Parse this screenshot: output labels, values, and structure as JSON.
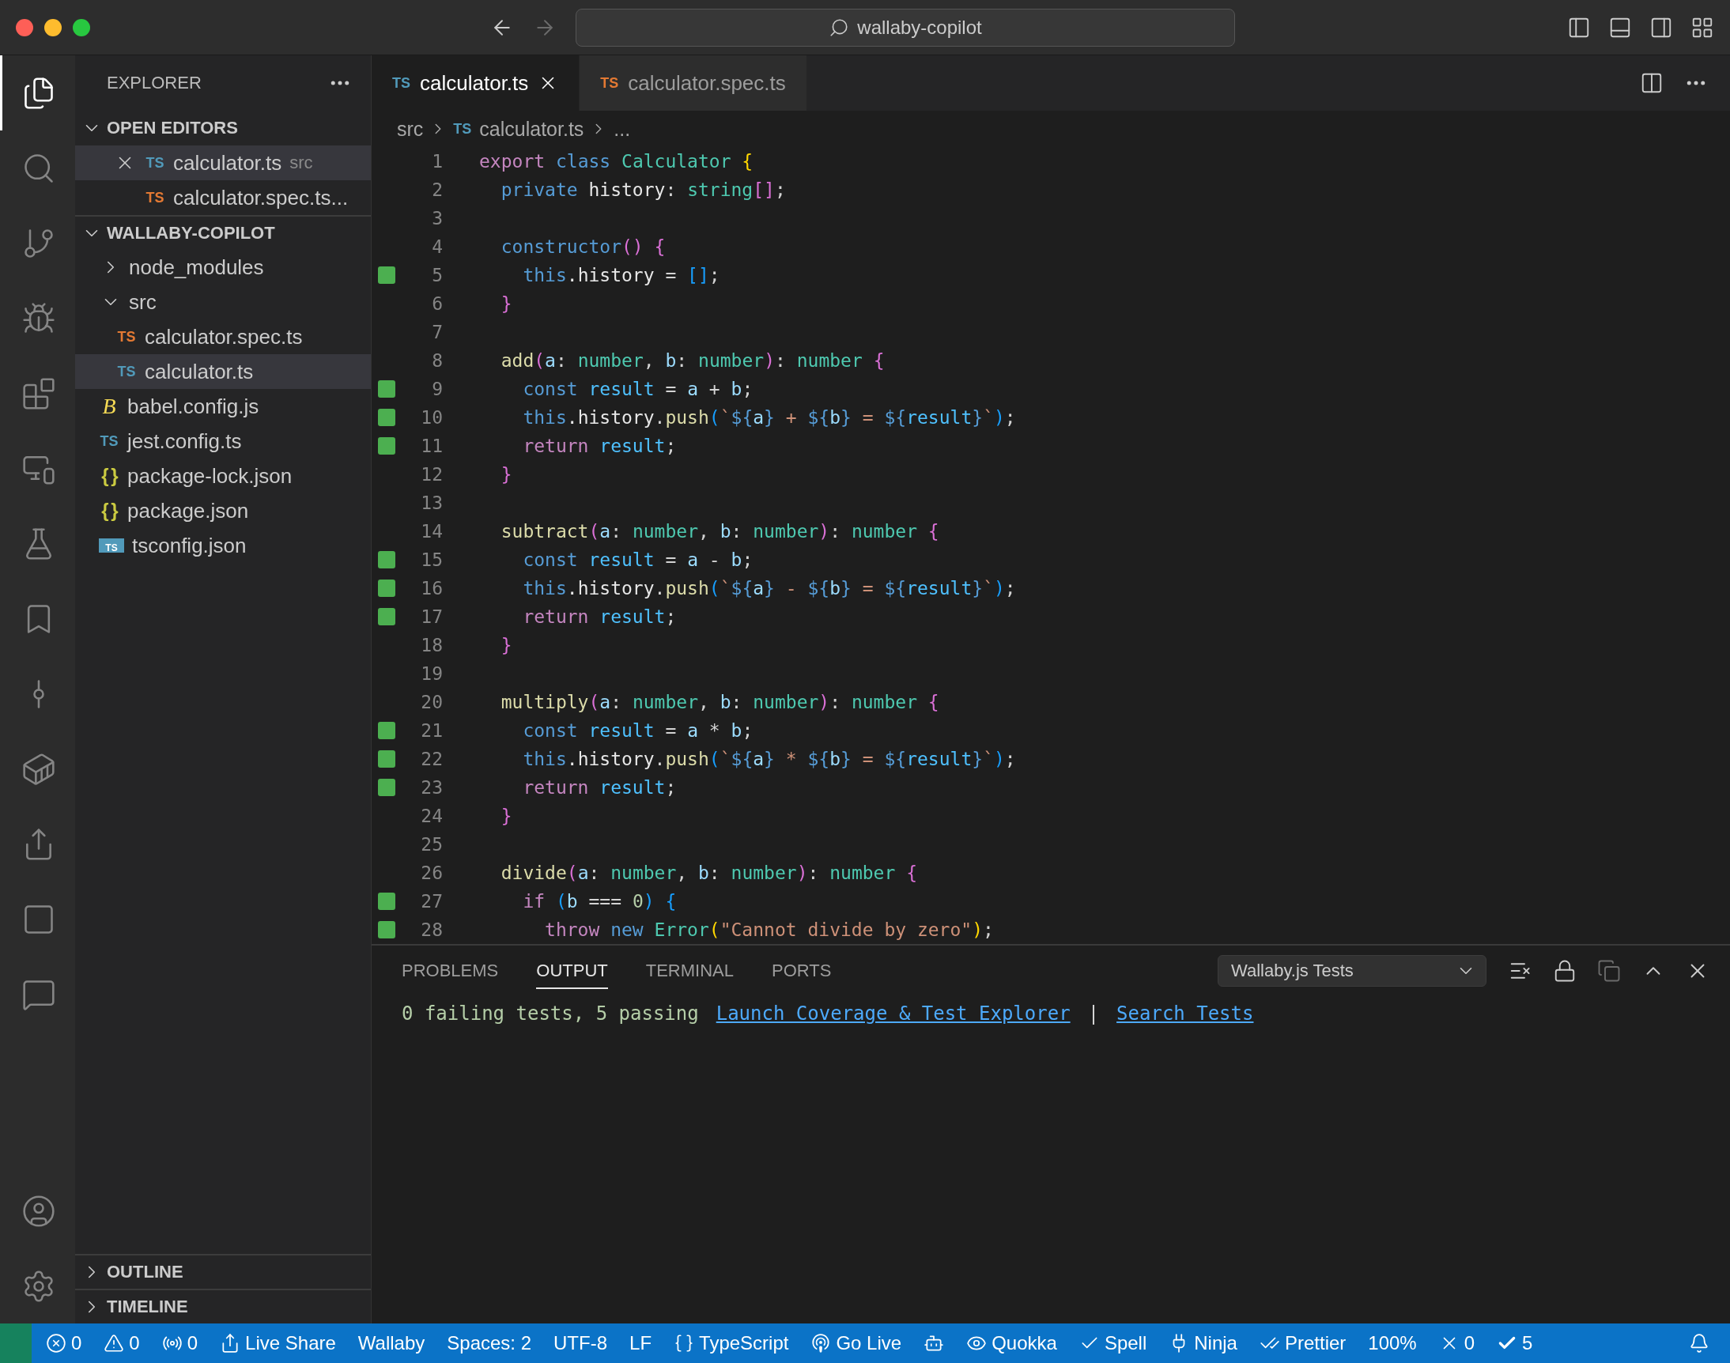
{
  "title_bar": {
    "search": "wallaby-copilot",
    "back_enabled": true,
    "forward_enabled": false
  },
  "activity_bar": [
    {
      "kind": "files",
      "selected": true
    },
    {
      "kind": "search",
      "selected": false
    },
    {
      "kind": "scm",
      "selected": false
    },
    {
      "kind": "debug",
      "selected": false
    },
    {
      "kind": "extensions",
      "selected": false
    },
    {
      "kind": "remote",
      "selected": false
    },
    {
      "kind": "testing",
      "selected": false
    },
    {
      "kind": "bookmarks",
      "selected": false
    },
    {
      "kind": "graph",
      "selected": false
    },
    {
      "kind": "docker",
      "selected": false
    },
    {
      "kind": "share",
      "selected": false
    },
    {
      "kind": "step",
      "selected": false
    },
    {
      "kind": "comments",
      "selected": false
    }
  ],
  "activity_bar_bottom": [
    {
      "kind": "account",
      "selected": false
    },
    {
      "kind": "settings",
      "selected": false
    }
  ],
  "sidebar": {
    "title": "EXPLORER",
    "open_editors": {
      "title": "OPEN EDITORS",
      "expanded": true,
      "items": [
        {
          "kind": "ts",
          "icon": "TS",
          "color": "#519aba",
          "name": "calculator.ts",
          "detail": "src",
          "selected": true
        },
        {
          "kind": "ts",
          "icon": "TS",
          "color": "#e37933",
          "name": "calculator.spec.ts...",
          "selected": false
        }
      ]
    },
    "project": {
      "title": "WALLABY-COPILOT",
      "expanded": true,
      "items": [
        {
          "kind": "folder",
          "name": "node_modules",
          "expanded": false,
          "selected": false
        },
        {
          "kind": "folder",
          "name": "src",
          "expanded": true,
          "selected": false,
          "children": [
            {
              "kind": "ts",
              "icon": "TS",
              "color": "#e37933",
              "name": "calculator.spec.ts",
              "selected": false
            },
            {
              "kind": "ts",
              "icon": "TS",
              "color": "#519aba",
              "name": "calculator.ts",
              "selected": true
            }
          ]
        },
        {
          "kind": "babel",
          "icon": "B",
          "color": "#f5da55",
          "name": "babel.config.js",
          "selected": false
        },
        {
          "kind": "ts",
          "icon": "TS",
          "color": "#519aba",
          "name": "jest.config.ts",
          "selected": false
        },
        {
          "kind": "json",
          "icon": "{ }",
          "color": "#cbcb41",
          "name": "package-lock.json",
          "selected": false
        },
        {
          "kind": "json",
          "icon": "{ }",
          "color": "#cbcb41",
          "name": "package.json",
          "selected": false
        },
        {
          "kind": "tsconfig",
          "icon": "TS",
          "color": "#519aba",
          "name": "tsconfig.json",
          "selected": false
        }
      ]
    },
    "bottom_sections": [
      {
        "title": "OUTLINE",
        "expanded": false
      },
      {
        "title": "TIMELINE",
        "expanded": false
      }
    ]
  },
  "tabs": [
    {
      "icon": "TS",
      "color": "#519aba",
      "label": "calculator.ts",
      "selected": true
    },
    {
      "icon": "TS",
      "color": "#e37933",
      "label": "calculator.spec.ts",
      "selected": false
    }
  ],
  "breadcrumb": [
    {
      "label": "src"
    },
    {
      "icon": "TS",
      "color": "#519aba",
      "label": "calculator.ts"
    },
    {
      "label": "..."
    }
  ],
  "code_lines": [
    {
      "number": "1",
      "covered": false,
      "tokens": [
        {
          "text": "export ",
          "kind": "kw"
        },
        {
          "text": "class ",
          "kind": "st"
        },
        {
          "text": "Calculator ",
          "kind": "ty"
        },
        {
          "text": "{",
          "kind": "b1"
        }
      ]
    },
    {
      "number": "2",
      "covered": false,
      "tokens": [
        {
          "text": "  private ",
          "kind": "st"
        },
        {
          "text": "history",
          "kind": "pr"
        },
        {
          "text": ": ",
          "kind": "p"
        },
        {
          "text": "string",
          "kind": "ty"
        },
        {
          "text": "[]",
          "kind": "b2"
        },
        {
          "text": ";",
          "kind": "p"
        }
      ]
    },
    {
      "number": "3",
      "covered": false
    },
    {
      "number": "4",
      "covered": false,
      "tokens": [
        {
          "text": "  constructor",
          "kind": "st"
        },
        {
          "text": "()",
          "kind": "b2"
        },
        {
          "text": " {",
          "kind": "b2"
        }
      ]
    },
    {
      "number": "5",
      "covered": true,
      "tokens": [
        {
          "text": "    this",
          "kind": "st"
        },
        {
          "text": ".history",
          "kind": "pr"
        },
        {
          "text": " = ",
          "kind": "p"
        },
        {
          "text": "[]",
          "kind": "b3"
        },
        {
          "text": ";",
          "kind": "p"
        }
      ]
    },
    {
      "number": "6",
      "covered": false,
      "tokens": [
        {
          "text": "  }",
          "kind": "b2"
        }
      ]
    },
    {
      "number": "7",
      "covered": false
    },
    {
      "number": "8",
      "covered": false,
      "tokens": [
        {
          "text": "  add",
          "kind": "fn"
        },
        {
          "text": "(",
          "kind": "b2"
        },
        {
          "text": "a",
          "kind": "pa"
        },
        {
          "text": ": ",
          "kind": "p"
        },
        {
          "text": "number",
          "kind": "ty"
        },
        {
          "text": ", ",
          "kind": "p"
        },
        {
          "text": "b",
          "kind": "pa"
        },
        {
          "text": ": ",
          "kind": "p"
        },
        {
          "text": "number",
          "kind": "ty"
        },
        {
          "text": ")",
          "kind": "b2"
        },
        {
          "text": ": ",
          "kind": "p"
        },
        {
          "text": "number ",
          "kind": "ty"
        },
        {
          "text": "{",
          "kind": "b2"
        }
      ]
    },
    {
      "number": "9",
      "covered": true,
      "tokens": [
        {
          "text": "    const ",
          "kind": "st"
        },
        {
          "text": "result",
          "kind": "cv"
        },
        {
          "text": " = ",
          "kind": "p"
        },
        {
          "text": "a",
          "kind": "pa"
        },
        {
          "text": " + ",
          "kind": "p"
        },
        {
          "text": "b",
          "kind": "pa"
        },
        {
          "text": ";",
          "kind": "p"
        }
      ]
    },
    {
      "number": "10",
      "covered": true,
      "tokens": [
        {
          "text": "    this",
          "kind": "st"
        },
        {
          "text": ".history",
          "kind": "pr"
        },
        {
          "text": ".",
          "kind": "p"
        },
        {
          "text": "push",
          "kind": "fn"
        },
        {
          "text": "(",
          "kind": "b3"
        },
        {
          "text": "`",
          "kind": "s"
        },
        {
          "text": "${",
          "kind": "tp"
        },
        {
          "text": "a",
          "kind": "pa"
        },
        {
          "text": "}",
          "kind": "tp"
        },
        {
          "text": " + ",
          "kind": "s"
        },
        {
          "text": "${",
          "kind": "tp"
        },
        {
          "text": "b",
          "kind": "pa"
        },
        {
          "text": "}",
          "kind": "tp"
        },
        {
          "text": " = ",
          "kind": "s"
        },
        {
          "text": "${",
          "kind": "tp"
        },
        {
          "text": "result",
          "kind": "cv"
        },
        {
          "text": "}",
          "kind": "tp"
        },
        {
          "text": "`",
          "kind": "s"
        },
        {
          "text": ")",
          "kind": "b3"
        },
        {
          "text": ";",
          "kind": "p"
        }
      ]
    },
    {
      "number": "11",
      "covered": true,
      "tokens": [
        {
          "text": "    return ",
          "kind": "kw"
        },
        {
          "text": "result",
          "kind": "cv"
        },
        {
          "text": ";",
          "kind": "p"
        }
      ]
    },
    {
      "number": "12",
      "covered": false,
      "tokens": [
        {
          "text": "  }",
          "kind": "b2"
        }
      ]
    },
    {
      "number": "13",
      "covered": false
    },
    {
      "number": "14",
      "covered": false,
      "tokens": [
        {
          "text": "  subtract",
          "kind": "fn"
        },
        {
          "text": "(",
          "kind": "b2"
        },
        {
          "text": "a",
          "kind": "pa"
        },
        {
          "text": ": ",
          "kind": "p"
        },
        {
          "text": "number",
          "kind": "ty"
        },
        {
          "text": ", ",
          "kind": "p"
        },
        {
          "text": "b",
          "kind": "pa"
        },
        {
          "text": ": ",
          "kind": "p"
        },
        {
          "text": "number",
          "kind": "ty"
        },
        {
          "text": ")",
          "kind": "b2"
        },
        {
          "text": ": ",
          "kind": "p"
        },
        {
          "text": "number ",
          "kind": "ty"
        },
        {
          "text": "{",
          "kind": "b2"
        }
      ]
    },
    {
      "number": "15",
      "covered": true,
      "tokens": [
        {
          "text": "    const ",
          "kind": "st"
        },
        {
          "text": "result",
          "kind": "cv"
        },
        {
          "text": " = ",
          "kind": "p"
        },
        {
          "text": "a",
          "kind": "pa"
        },
        {
          "text": " - ",
          "kind": "p"
        },
        {
          "text": "b",
          "kind": "pa"
        },
        {
          "text": ";",
          "kind": "p"
        }
      ]
    },
    {
      "number": "16",
      "covered": true,
      "tokens": [
        {
          "text": "    this",
          "kind": "st"
        },
        {
          "text": ".history",
          "kind": "pr"
        },
        {
          "text": ".",
          "kind": "p"
        },
        {
          "text": "push",
          "kind": "fn"
        },
        {
          "text": "(",
          "kind": "b3"
        },
        {
          "text": "`",
          "kind": "s"
        },
        {
          "text": "${",
          "kind": "tp"
        },
        {
          "text": "a",
          "kind": "pa"
        },
        {
          "text": "}",
          "kind": "tp"
        },
        {
          "text": " - ",
          "kind": "s"
        },
        {
          "text": "${",
          "kind": "tp"
        },
        {
          "text": "b",
          "kind": "pa"
        },
        {
          "text": "}",
          "kind": "tp"
        },
        {
          "text": " = ",
          "kind": "s"
        },
        {
          "text": "${",
          "kind": "tp"
        },
        {
          "text": "result",
          "kind": "cv"
        },
        {
          "text": "}",
          "kind": "tp"
        },
        {
          "text": "`",
          "kind": "s"
        },
        {
          "text": ")",
          "kind": "b3"
        },
        {
          "text": ";",
          "kind": "p"
        }
      ]
    },
    {
      "number": "17",
      "covered": true,
      "tokens": [
        {
          "text": "    return ",
          "kind": "kw"
        },
        {
          "text": "result",
          "kind": "cv"
        },
        {
          "text": ";",
          "kind": "p"
        }
      ]
    },
    {
      "number": "18",
      "covered": false,
      "tokens": [
        {
          "text": "  }",
          "kind": "b2"
        }
      ]
    },
    {
      "number": "19",
      "covered": false
    },
    {
      "number": "20",
      "covered": false,
      "tokens": [
        {
          "text": "  multiply",
          "kind": "fn"
        },
        {
          "text": "(",
          "kind": "b2"
        },
        {
          "text": "a",
          "kind": "pa"
        },
        {
          "text": ": ",
          "kind": "p"
        },
        {
          "text": "number",
          "kind": "ty"
        },
        {
          "text": ", ",
          "kind": "p"
        },
        {
          "text": "b",
          "kind": "pa"
        },
        {
          "text": ": ",
          "kind": "p"
        },
        {
          "text": "number",
          "kind": "ty"
        },
        {
          "text": ")",
          "kind": "b2"
        },
        {
          "text": ": ",
          "kind": "p"
        },
        {
          "text": "number ",
          "kind": "ty"
        },
        {
          "text": "{",
          "kind": "b2"
        }
      ]
    },
    {
      "number": "21",
      "covered": true,
      "tokens": [
        {
          "text": "    const ",
          "kind": "st"
        },
        {
          "text": "result",
          "kind": "cv"
        },
        {
          "text": " = ",
          "kind": "p"
        },
        {
          "text": "a",
          "kind": "pa"
        },
        {
          "text": " * ",
          "kind": "p"
        },
        {
          "text": "b",
          "kind": "pa"
        },
        {
          "text": ";",
          "kind": "p"
        }
      ]
    },
    {
      "number": "22",
      "covered": true,
      "tokens": [
        {
          "text": "    this",
          "kind": "st"
        },
        {
          "text": ".history",
          "kind": "pr"
        },
        {
          "text": ".",
          "kind": "p"
        },
        {
          "text": "push",
          "kind": "fn"
        },
        {
          "text": "(",
          "kind": "b3"
        },
        {
          "text": "`",
          "kind": "s"
        },
        {
          "text": "${",
          "kind": "tp"
        },
        {
          "text": "a",
          "kind": "pa"
        },
        {
          "text": "}",
          "kind": "tp"
        },
        {
          "text": " * ",
          "kind": "s"
        },
        {
          "text": "${",
          "kind": "tp"
        },
        {
          "text": "b",
          "kind": "pa"
        },
        {
          "text": "}",
          "kind": "tp"
        },
        {
          "text": " = ",
          "kind": "s"
        },
        {
          "text": "${",
          "kind": "tp"
        },
        {
          "text": "result",
          "kind": "cv"
        },
        {
          "text": "}",
          "kind": "tp"
        },
        {
          "text": "`",
          "kind": "s"
        },
        {
          "text": ")",
          "kind": "b3"
        },
        {
          "text": ";",
          "kind": "p"
        }
      ]
    },
    {
      "number": "23",
      "covered": true,
      "tokens": [
        {
          "text": "    return ",
          "kind": "kw"
        },
        {
          "text": "result",
          "kind": "cv"
        },
        {
          "text": ";",
          "kind": "p"
        }
      ]
    },
    {
      "number": "24",
      "covered": false,
      "tokens": [
        {
          "text": "  }",
          "kind": "b2"
        }
      ]
    },
    {
      "number": "25",
      "covered": false
    },
    {
      "number": "26",
      "covered": false,
      "tokens": [
        {
          "text": "  divide",
          "kind": "fn"
        },
        {
          "text": "(",
          "kind": "b2"
        },
        {
          "text": "a",
          "kind": "pa"
        },
        {
          "text": ": ",
          "kind": "p"
        },
        {
          "text": "number",
          "kind": "ty"
        },
        {
          "text": ", ",
          "kind": "p"
        },
        {
          "text": "b",
          "kind": "pa"
        },
        {
          "text": ": ",
          "kind": "p"
        },
        {
          "text": "number",
          "kind": "ty"
        },
        {
          "text": ")",
          "kind": "b2"
        },
        {
          "text": ": ",
          "kind": "p"
        },
        {
          "text": "number ",
          "kind": "ty"
        },
        {
          "text": "{",
          "kind": "b2"
        }
      ]
    },
    {
      "number": "27",
      "covered": true,
      "tokens": [
        {
          "text": "    if ",
          "kind": "kw"
        },
        {
          "text": "(",
          "kind": "b3"
        },
        {
          "text": "b",
          "kind": "pa"
        },
        {
          "text": " === ",
          "kind": "p"
        },
        {
          "text": "0",
          "kind": "n"
        },
        {
          "text": ")",
          "kind": "b3"
        },
        {
          "text": " {",
          "kind": "b3"
        }
      ]
    },
    {
      "number": "28",
      "covered": true,
      "tokens": [
        {
          "text": "      throw ",
          "kind": "kw"
        },
        {
          "text": "new ",
          "kind": "st"
        },
        {
          "text": "Error",
          "kind": "ty"
        },
        {
          "text": "(",
          "kind": "b1"
        },
        {
          "text": "\"Cannot divide by zero\"",
          "kind": "s"
        },
        {
          "text": ")",
          "kind": "b1"
        },
        {
          "text": ";",
          "kind": "p"
        }
      ]
    }
  ],
  "panel": {
    "tabs": [
      {
        "label": "PROBLEMS",
        "selected": false
      },
      {
        "label": "OUTPUT",
        "selected": true
      },
      {
        "label": "TERMINAL",
        "selected": false
      },
      {
        "label": "PORTS",
        "selected": false
      }
    ],
    "channel": "Wallaby.js Tests",
    "output": {
      "summary": "0 failing tests, 5 passing",
      "links": [
        "Launch Coverage & Test Explorer",
        "Search Tests"
      ],
      "separator": "|"
    }
  },
  "status_bar": [
    {
      "kind": "remote"
    },
    {
      "kind": "errors",
      "text": "0"
    },
    {
      "kind": "warnings",
      "text": "0"
    },
    {
      "kind": "ports",
      "text": "0"
    },
    {
      "kind": "liveshare",
      "text": "Live Share"
    },
    {
      "kind": "plain",
      "text": "Wallaby"
    },
    {
      "kind": "plain",
      "text": "Spaces: 2"
    },
    {
      "kind": "plain",
      "text": "UTF-8"
    },
    {
      "kind": "plain",
      "text": "LF"
    },
    {
      "kind": "language",
      "text": "TypeScript"
    },
    {
      "kind": "golive",
      "text": "Go Live"
    },
    {
      "kind": "copilot"
    },
    {
      "kind": "quokka",
      "text": "Quokka"
    },
    {
      "kind": "spell",
      "text": "Spell"
    },
    {
      "kind": "ninja",
      "text": "Ninja"
    },
    {
      "kind": "prettier",
      "text": "Prettier"
    },
    {
      "kind": "plain",
      "text": "100%"
    },
    {
      "kind": "failed",
      "text": "0"
    },
    {
      "kind": "passed",
      "text": "5"
    },
    {
      "kind": "bell"
    }
  ]
}
